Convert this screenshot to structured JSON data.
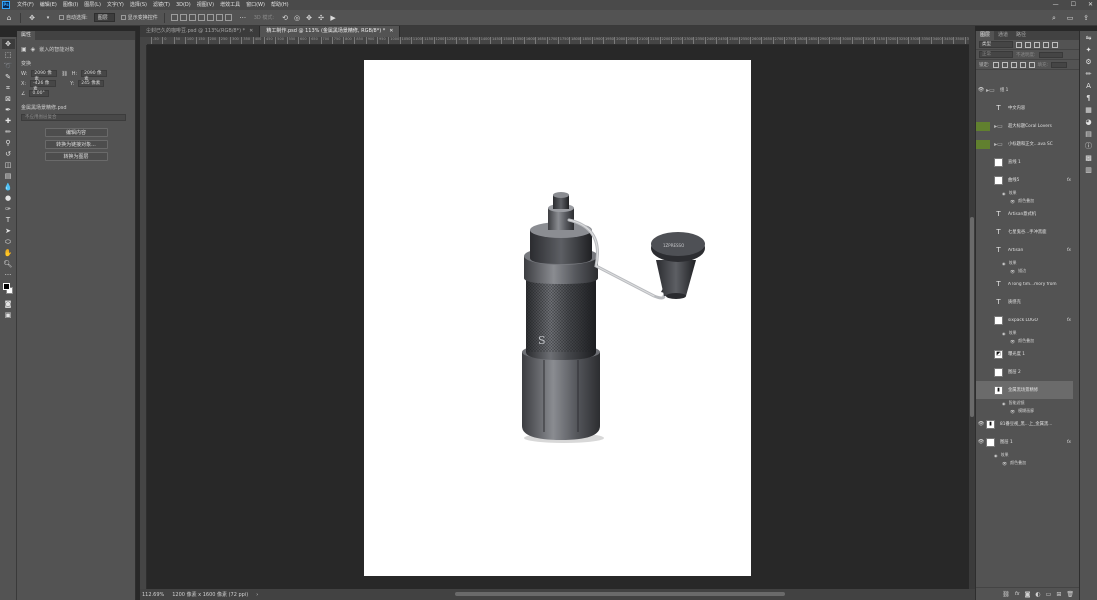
{
  "menubar": {
    "logo": "Ps",
    "items": [
      "文件(F)",
      "编辑(E)",
      "图像(I)",
      "图层(L)",
      "文字(Y)",
      "选择(S)",
      "滤镜(T)",
      "3D(D)",
      "视图(V)",
      "增效工具",
      "窗口(W)",
      "帮助(H)"
    ],
    "window_controls": [
      "—",
      "☐",
      "✕"
    ]
  },
  "optionsbar": {
    "auto_select_label": "自动选择:",
    "auto_select_value": "图层",
    "show_transform_label": "显示变换控件",
    "mode_3d_label": "3D 模式:"
  },
  "doc_tabs": [
    {
      "label": "尘封已久的咖啡豆.psd @ 113%(RGB/8*) *",
      "active": false
    },
    {
      "label": "精工制作.psd @ 113% (金属黑场景精修, RGB/8*) *",
      "active": true
    }
  ],
  "properties": {
    "tab": "属性",
    "type_label": "嵌入的智能对象",
    "transform_label": "变换",
    "w_label": "W:",
    "w_value": "2090 像素",
    "h_label": "H:",
    "h_value": "2090 像素",
    "x_label": "X:",
    "x_value": "-426 像素",
    "y_label": "Y:",
    "y_value": "245 像素",
    "angle_value": "0.00°",
    "file_name": "金属黑场景精修.psd",
    "comp_placeholder": "不应用图层复合",
    "buttons": [
      "编辑内容",
      "转换为链接对象...",
      "转换为图层"
    ]
  },
  "rulers": {
    "top": [
      "-50",
      "0",
      "50",
      "100",
      "150",
      "200",
      "250",
      "300",
      "350",
      "400",
      "450",
      "500",
      "550",
      "600",
      "650",
      "700",
      "750",
      "800",
      "850",
      "900",
      "950",
      "1000",
      "1050",
      "1100",
      "1150",
      "1200",
      "1250",
      "1300",
      "1350",
      "1400",
      "1450",
      "1500",
      "1550",
      "1600",
      "1650",
      "1700",
      "1750",
      "1800",
      "1850",
      "1900",
      "1950",
      "2000",
      "2050",
      "2100",
      "2150",
      "2200",
      "2250",
      "2300",
      "2350",
      "2400",
      "2450",
      "2500",
      "2550",
      "2600",
      "2650",
      "2700",
      "2750",
      "2800",
      "2850",
      "2900",
      "2950",
      "3000",
      "3050",
      "3100",
      "3150",
      "3200",
      "3250",
      "3300",
      "3350",
      "3400",
      "3450",
      "3500",
      "3550",
      "3600"
    ]
  },
  "statusbar": {
    "zoom": "112.69%",
    "doc_info": "1200 像素 x 1600 像素 (72 ppi)"
  },
  "layers_panel": {
    "tabs": [
      "图层",
      "通道",
      "路径"
    ],
    "kind_filter": "类型",
    "blend_mode": "正常",
    "opacity_label": "不透明度:",
    "lock_label": "锁定:",
    "fill_label": "填充:",
    "fx_label": "fx",
    "layers": [
      {
        "name": "组 1",
        "kind": "group",
        "eye": true,
        "indent": 0
      },
      {
        "name": "中文内容",
        "kind": "text",
        "eye": false,
        "indent": 1
      },
      {
        "name": "超大标题Coral Lovers",
        "kind": "group",
        "eye": false,
        "indent": 1,
        "green": true
      },
      {
        "name": "小标题和正文...ava SC",
        "kind": "group",
        "eye": false,
        "indent": 1,
        "green": true
      },
      {
        "name": "直线 1",
        "kind": "image",
        "eye": false,
        "indent": 1
      },
      {
        "name": "曲线5",
        "kind": "image",
        "eye": false,
        "indent": 1,
        "fx": true
      },
      {
        "name": "效果",
        "kind": "effects",
        "indent": 2
      },
      {
        "name": "颜色叠加",
        "kind": "effect",
        "indent": 3
      },
      {
        "name": "Artisan意式机",
        "kind": "text",
        "eye": false,
        "indent": 1
      },
      {
        "name": "七星鬼谷...手冲黑鹿",
        "kind": "text",
        "eye": false,
        "indent": 1
      },
      {
        "name": "Artisan",
        "kind": "text",
        "eye": false,
        "indent": 1,
        "fx": true
      },
      {
        "name": "效果",
        "kind": "effects",
        "indent": 2
      },
      {
        "name": "描边",
        "kind": "effect",
        "indent": 3
      },
      {
        "name": "A long tim...mory from",
        "kind": "text",
        "eye": false,
        "indent": 1
      },
      {
        "name": "质感克",
        "kind": "text",
        "eye": false,
        "indent": 1
      },
      {
        "name": "sixpack LOGO",
        "kind": "image",
        "eye": false,
        "indent": 1,
        "fx": true
      },
      {
        "name": "效果",
        "kind": "effects",
        "indent": 2
      },
      {
        "name": "颜色叠加",
        "kind": "effect",
        "indent": 3
      },
      {
        "name": "曝光度 1",
        "kind": "adjust",
        "eye": false,
        "indent": 1
      },
      {
        "name": "图层 2",
        "kind": "image",
        "eye": false,
        "indent": 1
      },
      {
        "name": "金属黑场景精修",
        "kind": "smart",
        "eye": false,
        "indent": 1,
        "selected": true
      },
      {
        "name": "智能滤镜",
        "kind": "filter",
        "indent": 2
      },
      {
        "name": "模糊画廊",
        "kind": "effect",
        "indent": 3
      },
      {
        "name": "81番豆视_黑...上_金属黑...",
        "kind": "smart",
        "eye": true,
        "indent": 0
      },
      {
        "name": "图层 1",
        "kind": "image",
        "eye": true,
        "indent": 0,
        "fx": true
      },
      {
        "name": "效果",
        "kind": "effects",
        "indent": 1
      },
      {
        "name": "颜色叠加",
        "kind": "effect",
        "indent": 2
      }
    ]
  },
  "colors": {
    "panel": "#535353",
    "workspace": "#282828",
    "accent": "#31a8ff",
    "layer_green": "#61802f"
  }
}
